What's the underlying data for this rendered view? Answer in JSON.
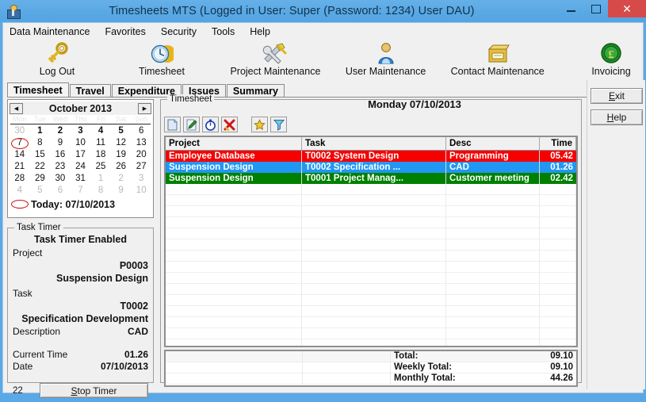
{
  "window": {
    "title": "Timesheets MTS (Logged in User: Super (Password: 1234) User DAU)",
    "app_icon": "user-card-icon",
    "minimize": "–",
    "maximize": "□",
    "close": "✕"
  },
  "menubar": {
    "items": [
      "Data Maintenance",
      "Favorites",
      "Security",
      "Tools",
      "Help"
    ]
  },
  "toolbar": {
    "items": [
      {
        "label": "Log Out",
        "icon": "key-icon"
      },
      {
        "label": "Timesheet",
        "icon": "clock-icon"
      },
      {
        "label": "Project Maintenance",
        "icon": "tools-icon"
      },
      {
        "label": "User Maintenance",
        "icon": "person-icon"
      },
      {
        "label": "Contact Maintenance",
        "icon": "card-file-icon"
      },
      {
        "label": "Invoicing",
        "icon": "pound-coin-icon"
      }
    ]
  },
  "tabs": {
    "items": [
      "Timesheet",
      "Travel",
      "Expenditure",
      "Issues",
      "Summary"
    ],
    "active": "Timesheet"
  },
  "side_buttons": {
    "exit": "Exit",
    "help": "Help"
  },
  "calendar": {
    "prev": "◀",
    "next": "▶",
    "month": "October 2013",
    "dow": [
      "Mon",
      "Tue",
      "Wed",
      "Thu",
      "Fri",
      "Sat",
      "Sun"
    ],
    "weeks": [
      [
        {
          "d": "30",
          "s": "dim"
        },
        {
          "d": "1",
          "s": "bold"
        },
        {
          "d": "2",
          "s": "bold"
        },
        {
          "d": "3",
          "s": "bold"
        },
        {
          "d": "4",
          "s": "bold"
        },
        {
          "d": "5",
          "s": "bold"
        },
        {
          "d": "6",
          "s": ""
        }
      ],
      [
        {
          "d": "7",
          "s": "today"
        },
        {
          "d": "8",
          "s": ""
        },
        {
          "d": "9",
          "s": ""
        },
        {
          "d": "10",
          "s": ""
        },
        {
          "d": "11",
          "s": ""
        },
        {
          "d": "12",
          "s": ""
        },
        {
          "d": "13",
          "s": ""
        }
      ],
      [
        {
          "d": "14",
          "s": ""
        },
        {
          "d": "15",
          "s": ""
        },
        {
          "d": "16",
          "s": ""
        },
        {
          "d": "17",
          "s": ""
        },
        {
          "d": "18",
          "s": ""
        },
        {
          "d": "19",
          "s": ""
        },
        {
          "d": "20",
          "s": ""
        }
      ],
      [
        {
          "d": "21",
          "s": ""
        },
        {
          "d": "22",
          "s": ""
        },
        {
          "d": "23",
          "s": ""
        },
        {
          "d": "24",
          "s": ""
        },
        {
          "d": "25",
          "s": ""
        },
        {
          "d": "26",
          "s": ""
        },
        {
          "d": "27",
          "s": ""
        }
      ],
      [
        {
          "d": "28",
          "s": ""
        },
        {
          "d": "29",
          "s": ""
        },
        {
          "d": "30",
          "s": ""
        },
        {
          "d": "31",
          "s": ""
        },
        {
          "d": "1",
          "s": "dim"
        },
        {
          "d": "2",
          "s": "dim"
        },
        {
          "d": "3",
          "s": "dim"
        }
      ],
      [
        {
          "d": "4",
          "s": "dim"
        },
        {
          "d": "5",
          "s": "dim"
        },
        {
          "d": "6",
          "s": "dim"
        },
        {
          "d": "7",
          "s": "dim"
        },
        {
          "d": "8",
          "s": "dim"
        },
        {
          "d": "9",
          "s": "dim"
        },
        {
          "d": "10",
          "s": "dim"
        }
      ]
    ],
    "today_label": "Today: 07/10/2013"
  },
  "task_timer": {
    "group_title": "Task Timer",
    "status": "Task Timer Enabled",
    "project_label": "Project",
    "project_code": "P0003",
    "project_name": "Suspension Design",
    "task_label": "Task",
    "task_code": "T0002",
    "task_name": "Specification Development",
    "description_label": "Description",
    "description_value": "CAD",
    "current_time_label": "Current Time",
    "current_time_value": "01.26",
    "date_label": "Date",
    "date_value": "07/10/2013",
    "counter": "22",
    "stop_button": "Stop Timer"
  },
  "timesheet": {
    "group_title": "Timesheet",
    "date_header": "Monday 07/10/2013",
    "tools": [
      {
        "name": "new-record-icon",
        "title": "New"
      },
      {
        "name": "edit-record-icon",
        "title": "Edit"
      },
      {
        "name": "timer-icon",
        "title": "Timer"
      },
      {
        "name": "delete-record-icon",
        "title": "Delete"
      },
      {
        "name": "favorite-star-icon",
        "title": "Favorite"
      },
      {
        "name": "filter-funnel-icon",
        "title": "Filter"
      }
    ],
    "columns": [
      "Project",
      "Task",
      "Desc",
      "Time"
    ],
    "rows": [
      {
        "project": "Employee Database",
        "task": "T0002 System Design",
        "desc": "Programming",
        "time": "05.42",
        "color": "#f60000"
      },
      {
        "project": "Suspension Design",
        "task": "T0002 Specification ...",
        "desc": "CAD",
        "time": "01.26",
        "color": "#2196f3"
      },
      {
        "project": "Suspension Design",
        "task": "T0001 Project Manag...",
        "desc": "Customer meeting",
        "time": "02.42",
        "color": "#008000"
      }
    ],
    "empty_row_count": 17,
    "totals": [
      {
        "label": "Total:",
        "value": "09.10"
      },
      {
        "label": "Weekly Total:",
        "value": "09.10"
      },
      {
        "label": "Monthly Total:",
        "value": "44.26"
      }
    ]
  },
  "colors": {
    "titlebar": "#5aa9e6",
    "close_button": "#d64a4a",
    "face": "#f0f0f0",
    "row_red": "#f60000",
    "row_blue": "#2196f3",
    "row_green": "#008000"
  }
}
